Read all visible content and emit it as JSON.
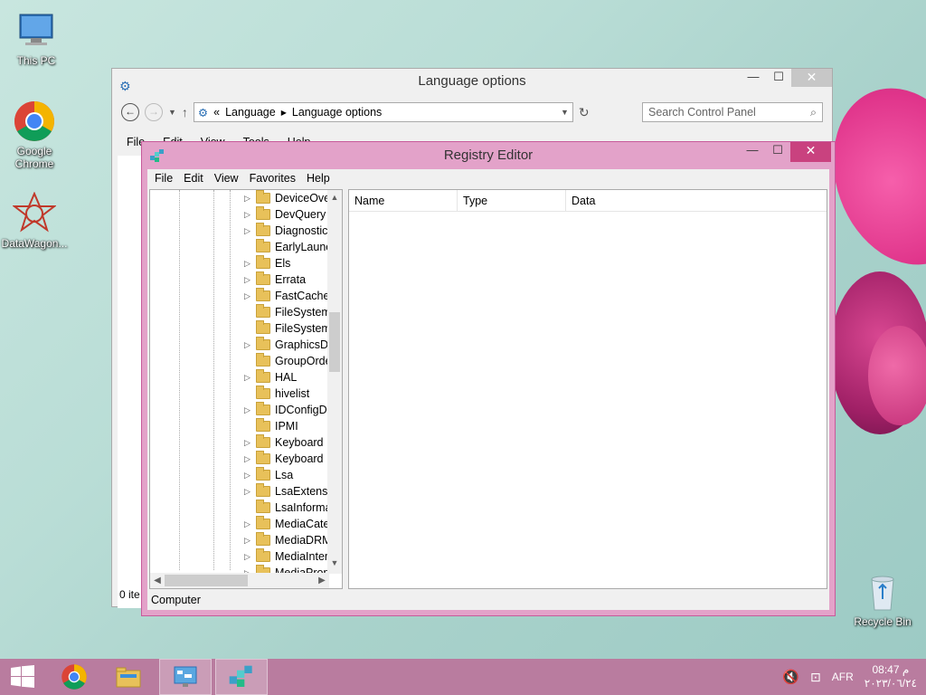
{
  "desktop": {
    "icons": [
      {
        "label": "This PC"
      },
      {
        "label": "Google Chrome"
      },
      {
        "label": "DataWagon..."
      },
      {
        "label": "Recycle Bin"
      }
    ]
  },
  "language_window": {
    "title": "Language options",
    "breadcrumb": [
      "Language",
      "Language options"
    ],
    "breadcrumb_prefix": "«",
    "search_placeholder": "Search Control Panel",
    "menu": [
      "File",
      "Edit",
      "View",
      "Tools",
      "Help"
    ],
    "status": "0 ite"
  },
  "registry": {
    "title": "Registry Editor",
    "menu": [
      "File",
      "Edit",
      "View",
      "Favorites",
      "Help"
    ],
    "tree": [
      {
        "label": "DeviceOve",
        "expandable": true
      },
      {
        "label": "DevQuery",
        "expandable": true
      },
      {
        "label": "Diagnostic",
        "expandable": true
      },
      {
        "label": "EarlyLaunc",
        "expandable": false
      },
      {
        "label": "Els",
        "expandable": true
      },
      {
        "label": "Errata",
        "expandable": true
      },
      {
        "label": "FastCache",
        "expandable": true
      },
      {
        "label": "FileSystem",
        "expandable": false
      },
      {
        "label": "FileSystem",
        "expandable": false
      },
      {
        "label": "GraphicsDr",
        "expandable": true
      },
      {
        "label": "GroupOrde",
        "expandable": false
      },
      {
        "label": "HAL",
        "expandable": true
      },
      {
        "label": "hivelist",
        "expandable": false
      },
      {
        "label": "IDConfigDl",
        "expandable": true
      },
      {
        "label": "IPMI",
        "expandable": false
      },
      {
        "label": "Keyboard L",
        "expandable": true
      },
      {
        "label": "Keyboard L",
        "expandable": true
      },
      {
        "label": "Lsa",
        "expandable": true
      },
      {
        "label": "LsaExtensic",
        "expandable": true
      },
      {
        "label": "LsaInforma",
        "expandable": false
      },
      {
        "label": "MediaCate",
        "expandable": true
      },
      {
        "label": "MediaDRM",
        "expandable": true
      },
      {
        "label": "MediaInter",
        "expandable": true
      },
      {
        "label": "MediaProp",
        "expandable": true
      }
    ],
    "columns": [
      "Name",
      "Type",
      "Data"
    ],
    "status": "Computer"
  },
  "taskbar": {
    "language": "AFR",
    "time": "08:47 م",
    "date": "٢٠٢٣/٠٦/٢٤"
  },
  "colors": {
    "registry_frame": "#e3a2c9",
    "taskbar": "#b97c9f",
    "close_button": "#c9427f"
  }
}
